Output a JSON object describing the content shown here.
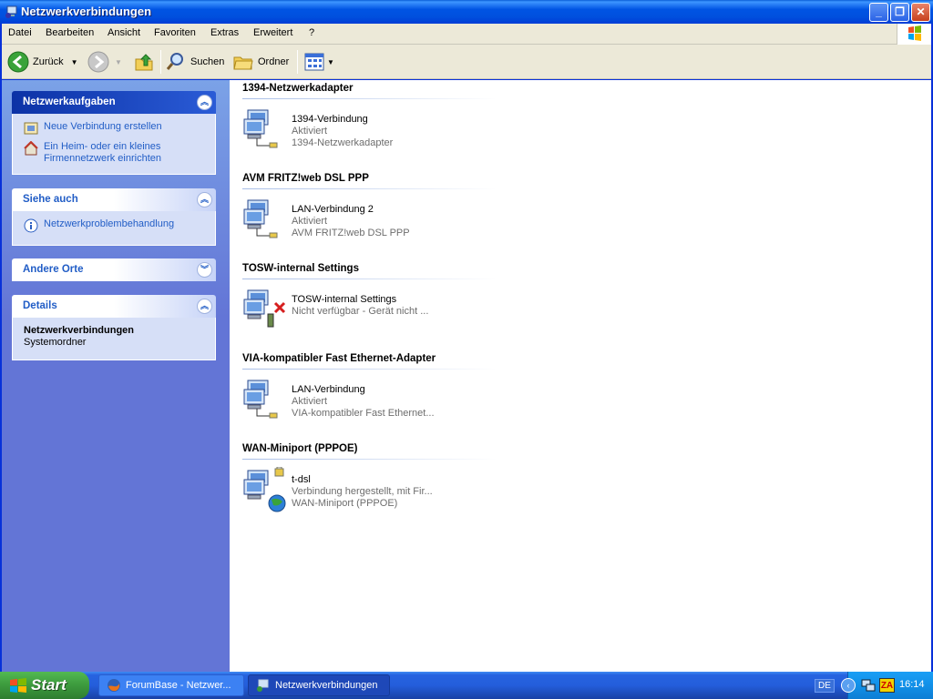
{
  "window": {
    "title": "Netzwerkverbindungen",
    "controls": [
      "minimize",
      "maximize",
      "close"
    ]
  },
  "menu": [
    "Datei",
    "Bearbeiten",
    "Ansicht",
    "Favoriten",
    "Extras",
    "Erweitert",
    "?"
  ],
  "toolbar": {
    "back": "Zurück",
    "search": "Suchen",
    "folders": "Ordner"
  },
  "sidebar": {
    "tasks": {
      "title": "Netzwerkaufgaben",
      "items": [
        {
          "label": "Neue Verbindung erstellen",
          "icon": "new-connection-icon"
        },
        {
          "label": "Ein Heim- oder ein kleines Firmennetzwerk einrichten",
          "icon": "home-network-icon"
        }
      ]
    },
    "see_also": {
      "title": "Siehe auch",
      "items": [
        {
          "label": "Netzwerkproblembehandlung",
          "icon": "info-icon"
        }
      ]
    },
    "other_places": {
      "title": "Andere Orte"
    },
    "details": {
      "title": "Details",
      "name": "Netzwerkverbindungen",
      "type": "Systemordner"
    }
  },
  "groups": [
    {
      "heading": "1394-Netzwerkadapter",
      "item": {
        "name": "1394-Verbindung",
        "status": "Aktiviert",
        "device": "1394-Netzwerkadapter",
        "icon": "lan-connection-icon"
      }
    },
    {
      "heading": "AVM FRITZ!web DSL PPP",
      "item": {
        "name": "LAN-Verbindung 2",
        "status": "Aktiviert",
        "device": "AVM FRITZ!web DSL PPP",
        "icon": "lan-connection-icon"
      }
    },
    {
      "heading": "TOSW-internal Settings",
      "item": {
        "name": "TOSW-internal Settings",
        "status": "Nicht verfügbar - Gerät nicht ...",
        "device": "",
        "icon": "disabled-connection-icon"
      }
    },
    {
      "heading": "VIA-kompatibler Fast Ethernet-Adapter",
      "item": {
        "name": "LAN-Verbindung",
        "status": "Aktiviert",
        "device": "VIA-kompatibler Fast Ethernet...",
        "icon": "lan-connection-icon"
      }
    },
    {
      "heading": "WAN-Miniport (PPPOE)",
      "item": {
        "name": "t-dsl",
        "status": "Verbindung hergestellt, mit Fir...",
        "device": "WAN-Miniport (PPPOE)",
        "icon": "dialup-connection-icon"
      }
    }
  ],
  "taskbar": {
    "start": "Start",
    "tasks": [
      {
        "label": "ForumBase - Netzwer...",
        "active": false
      },
      {
        "label": "Netzwerkverbindungen",
        "active": true
      }
    ],
    "lang": "DE",
    "clock": "16:14"
  }
}
